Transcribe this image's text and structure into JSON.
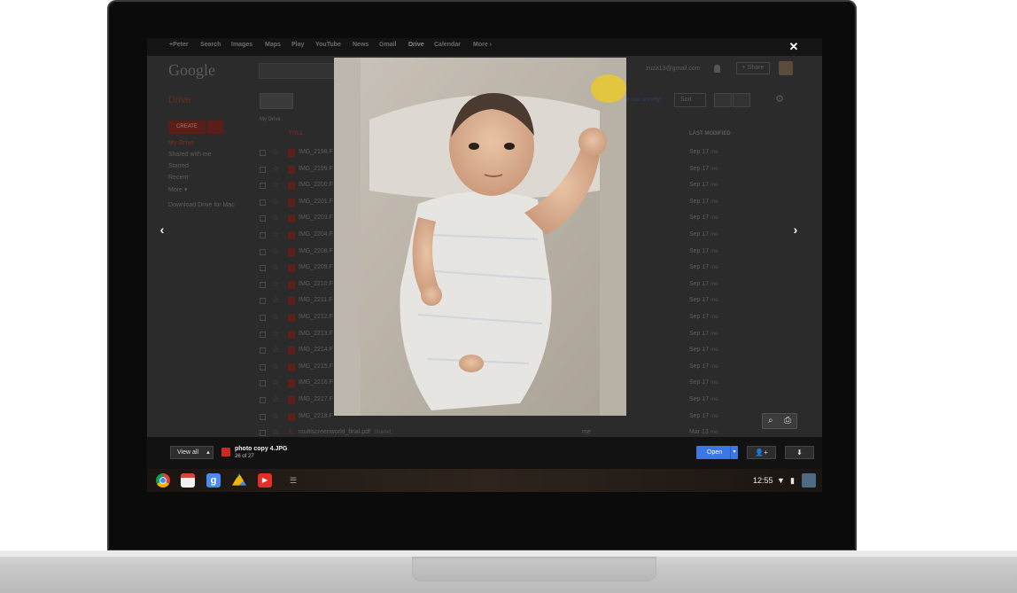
{
  "gbar": {
    "items": [
      "+Peter",
      "Search",
      "Images",
      "Maps",
      "Play",
      "YouTube",
      "News",
      "Gmail",
      "Drive",
      "Calendar",
      "More ›"
    ]
  },
  "drive": {
    "logo": "Google",
    "title": "Drive",
    "user_email": "zuza13@gmail.com",
    "share_label": "+ Share",
    "create_label": "CREATE",
    "nav": [
      "My Drive",
      "Shared with me",
      "Starred",
      "Recent",
      "More ▾"
    ],
    "download_link": "Download Drive for Mac",
    "breadcrumb": "My Drive",
    "survey_link": "ke our survey!",
    "sort_label": "Sort",
    "col_title": "TITLE",
    "col_modified": "LAST MODIFIED",
    "files": [
      {
        "name": "IMG_2198.F",
        "date": "Sep 17",
        "by": "me"
      },
      {
        "name": "IMG_2199.F",
        "date": "Sep 17",
        "by": "me"
      },
      {
        "name": "IMG_2200.F",
        "date": "Sep 17",
        "by": "me"
      },
      {
        "name": "IMG_2201.F",
        "date": "Sep 17",
        "by": "me"
      },
      {
        "name": "IMG_2203.F",
        "date": "Sep 17",
        "by": "me"
      },
      {
        "name": "IMG_2204.F",
        "date": "Sep 17",
        "by": "me"
      },
      {
        "name": "IMG_2208.F",
        "date": "Sep 17",
        "by": "me"
      },
      {
        "name": "IMG_2209.F",
        "date": "Sep 17",
        "by": "me"
      },
      {
        "name": "IMG_2210.F",
        "date": "Sep 17",
        "by": "me"
      },
      {
        "name": "IMG_2211.F",
        "date": "Sep 17",
        "by": "me"
      },
      {
        "name": "IMG_2212.F",
        "date": "Sep 17",
        "by": "me"
      },
      {
        "name": "IMG_2213.F",
        "date": "Sep 17",
        "by": "me"
      },
      {
        "name": "IMG_2214.F",
        "date": "Sep 17",
        "by": "me"
      },
      {
        "name": "IMG_2215.F",
        "date": "Sep 17",
        "by": "me"
      },
      {
        "name": "IMG_2216.F",
        "date": "Sep 17",
        "by": "me"
      },
      {
        "name": "IMG_2217.F",
        "date": "Sep 17",
        "by": "me"
      },
      {
        "name": "IMG_2218.F",
        "date": "Sep 17",
        "by": "me"
      }
    ],
    "last_file": {
      "name": "multiscreenworld_final.pdf",
      "shared": "Shared",
      "owner": "me",
      "date": "Mar 13",
      "by": "me"
    }
  },
  "viewer": {
    "close_label": "✕",
    "prev_label": "‹",
    "next_label": "›",
    "view_all_label": "View all",
    "file_title": "photo copy 4.JPG",
    "file_count": "26 of 27",
    "open_label": "Open"
  },
  "shelf": {
    "apps": [
      "chrome-icon",
      "gmail-icon",
      "google-search-icon",
      "drive-icon",
      "youtube-icon"
    ],
    "clock": "12:55"
  },
  "colors": {
    "open_button": "#3b78e7",
    "image_icon": "#c62c22"
  }
}
